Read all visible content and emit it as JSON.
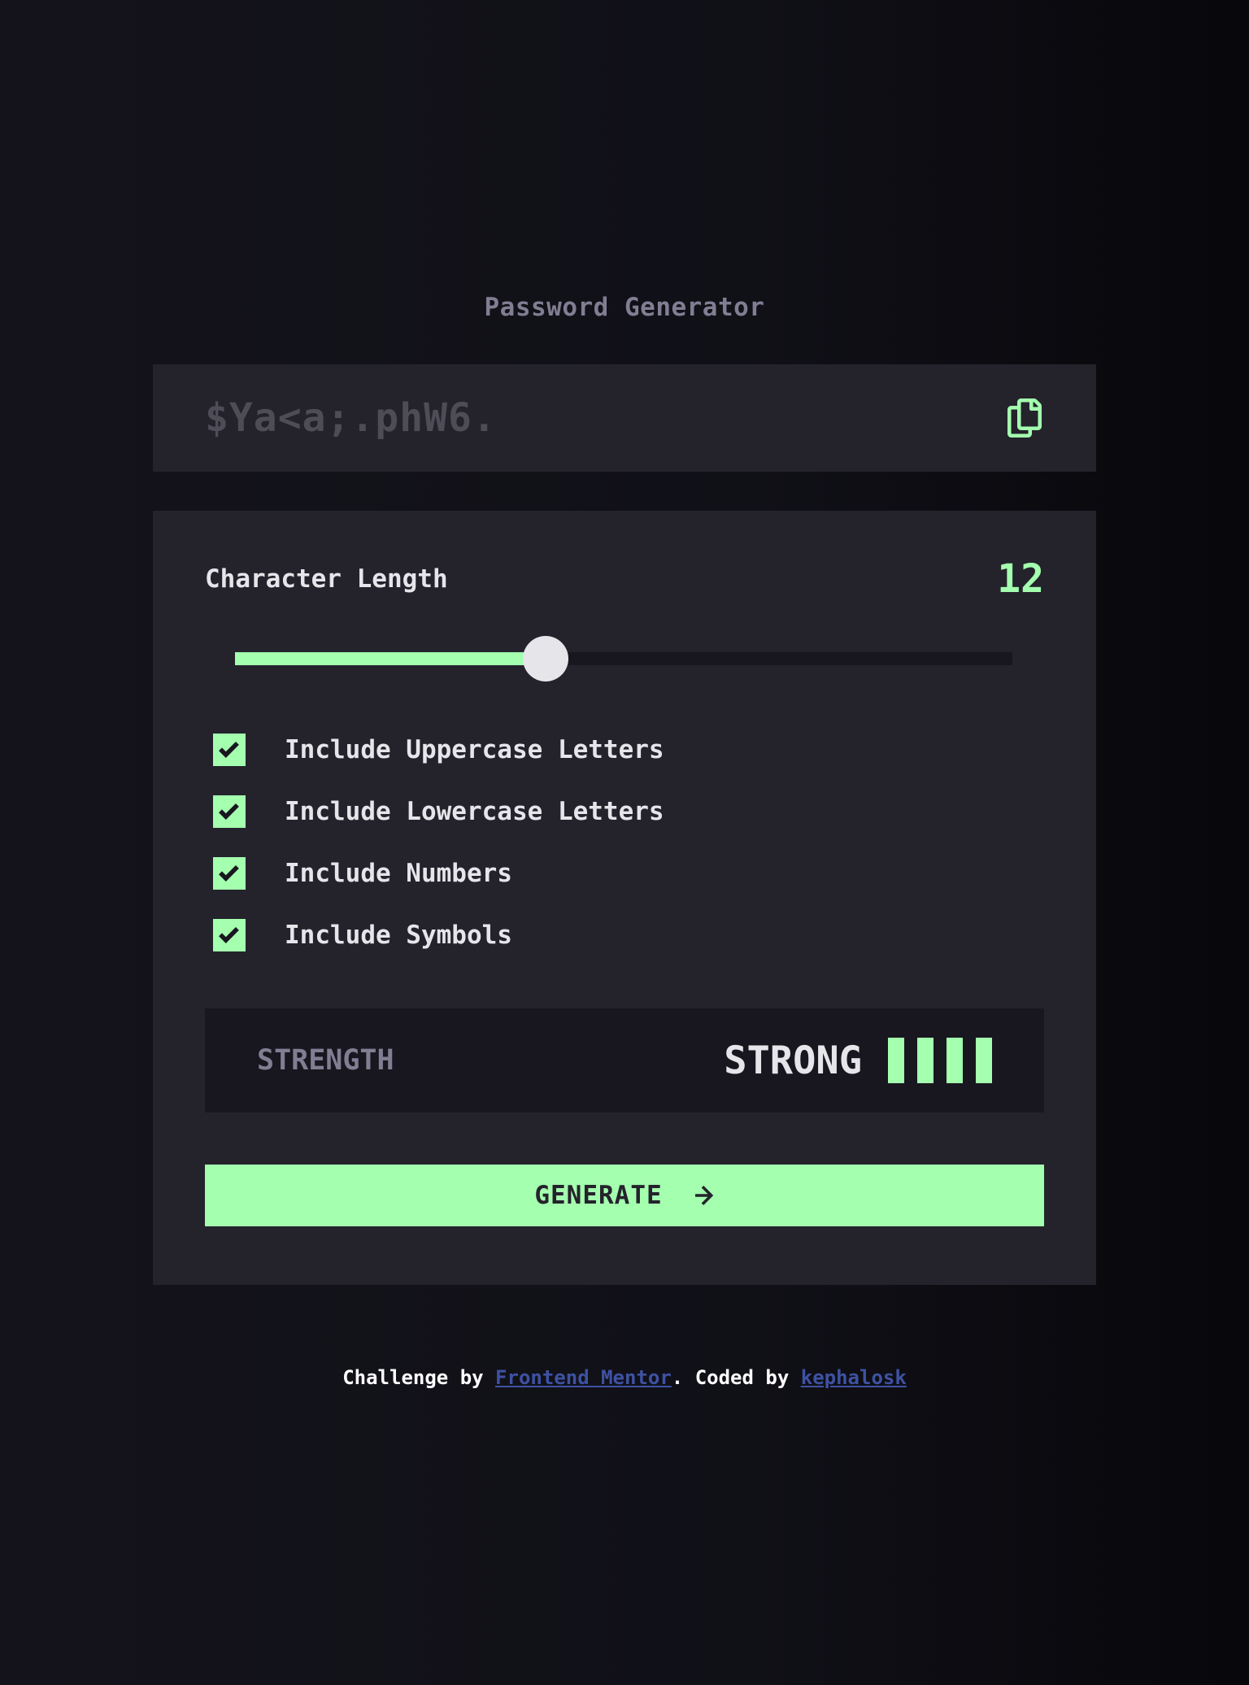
{
  "app": {
    "title": "Password Generator"
  },
  "output": {
    "password": "$Ya<a;.phW6.",
    "copy_icon": "copy-icon"
  },
  "length": {
    "label": "Character Length",
    "value": "12",
    "slider_fraction": 0.4
  },
  "options": [
    {
      "label": "Include Uppercase Letters",
      "checked": true
    },
    {
      "label": "Include Lowercase Letters",
      "checked": true
    },
    {
      "label": "Include Numbers",
      "checked": true
    },
    {
      "label": "Include Symbols",
      "checked": true
    }
  ],
  "strength": {
    "label": "STRENGTH",
    "value": "STRONG",
    "level": 4,
    "max_level": 4
  },
  "generate": {
    "label": "GENERATE",
    "icon": "arrow-right-icon"
  },
  "footer": {
    "prefix": "Challenge by ",
    "link1": "Frontend Mentor",
    "middle": ". Coded by ",
    "link2": "kephalosk"
  },
  "colors": {
    "accent": "#a4ffaf",
    "panel": "#24232c",
    "dark": "#18171f",
    "muted": "#817d92",
    "text": "#e6e5ea",
    "link": "#3e52a3"
  }
}
